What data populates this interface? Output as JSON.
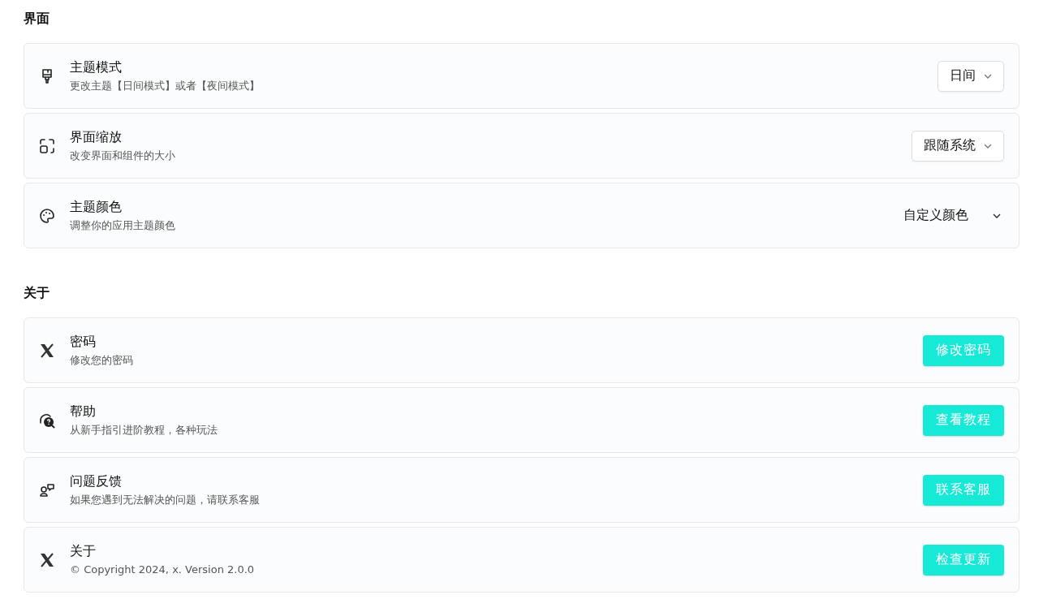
{
  "sections": [
    {
      "title": "界面",
      "items": [
        {
          "title": "主题模式",
          "description": "更改主题【日间模式】或者【夜间模式】",
          "kind": "select",
          "value": "日间"
        },
        {
          "title": "界面缩放",
          "description": "改变界面和组件的大小",
          "kind": "select",
          "value": "跟随系统"
        },
        {
          "title": "主题颜色",
          "description": "调整你的应用主题颜色",
          "kind": "plain-select",
          "value": "自定义颜色"
        }
      ]
    },
    {
      "title": "关于",
      "items": [
        {
          "title": "密码",
          "description": "修改您的密码",
          "kind": "button",
          "value": "修改密码"
        },
        {
          "title": "帮助",
          "description": "从新手指引进阶教程，各种玩法",
          "kind": "button",
          "value": "查看教程"
        },
        {
          "title": "问题反馈",
          "description": "如果您遇到无法解决的问题，请联系客服",
          "kind": "button",
          "value": "联系客服"
        },
        {
          "title": "关于",
          "description": "© Copyright 2024, x. Version 2.0.0",
          "kind": "button",
          "value": "检查更新"
        }
      ]
    }
  ]
}
